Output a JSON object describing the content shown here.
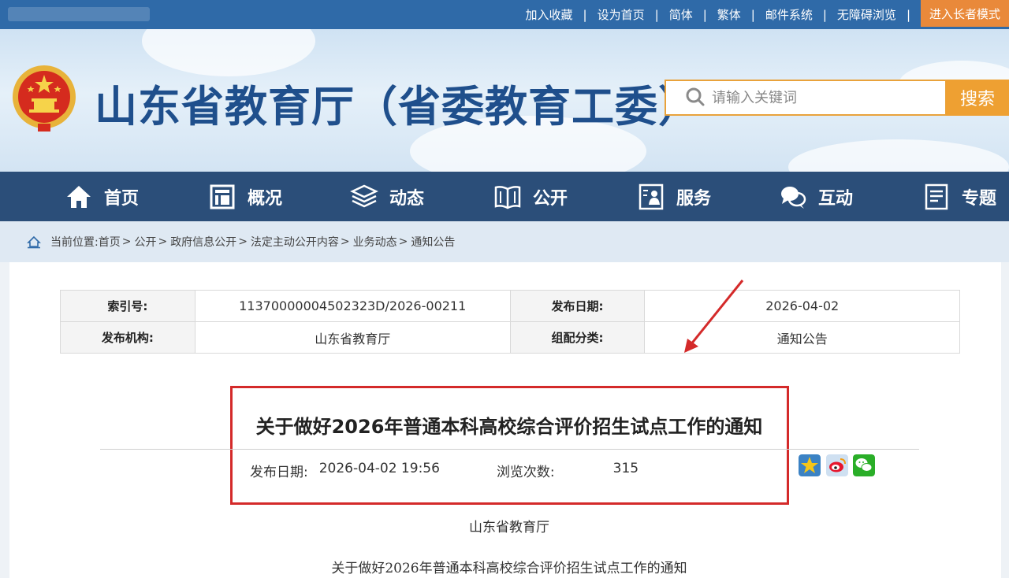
{
  "topbar": {
    "links": [
      "加入收藏",
      "设为首页",
      "简体",
      "繁体",
      "邮件系统",
      "无障碍浏览"
    ],
    "elder_mode": "进入长者模式"
  },
  "header": {
    "site_title": "山东省教育厅（省委教育工委）",
    "search_placeholder": "请输入关键词",
    "search_button": "搜索"
  },
  "nav": {
    "items": [
      {
        "label": "首页",
        "icon": "home-icon"
      },
      {
        "label": "概况",
        "icon": "building-icon"
      },
      {
        "label": "动态",
        "icon": "stack-icon"
      },
      {
        "label": "公开",
        "icon": "book-icon"
      },
      {
        "label": "服务",
        "icon": "service-icon"
      },
      {
        "label": "互动",
        "icon": "chat-icon"
      },
      {
        "label": "专题",
        "icon": "document-icon"
      }
    ]
  },
  "breadcrumb": {
    "prefix": "当前位置: ",
    "items": [
      "首页",
      "公开",
      "政府信息公开",
      "法定主动公开内容",
      "业务动态",
      "通知公告"
    ]
  },
  "meta": {
    "index_label": "索引号:",
    "index_value": "11370000004502323D/2026-00211",
    "date_label": "发布日期:",
    "date_value": "2026-04-02",
    "org_label": "发布机构:",
    "org_value": "山东省教育厅",
    "category_label": "组配分类:",
    "category_value": "通知公告"
  },
  "article": {
    "title": "关于做好2026年普通本科高校综合评价招生试点工作的通知",
    "pub_label": "发布日期:",
    "pub_value": "2026-04-02 19:56",
    "views_label": "浏览次数:",
    "views_value": "315",
    "body_unit": "山东省教育厅",
    "body_title": "关于做好2026年普通本科高校综合评价招生试点工作的通知"
  },
  "colors": {
    "topbar": "#2f6aa8",
    "nav": "#2b4e79",
    "accent": "#eea032",
    "highlight": "#d42a2a"
  }
}
